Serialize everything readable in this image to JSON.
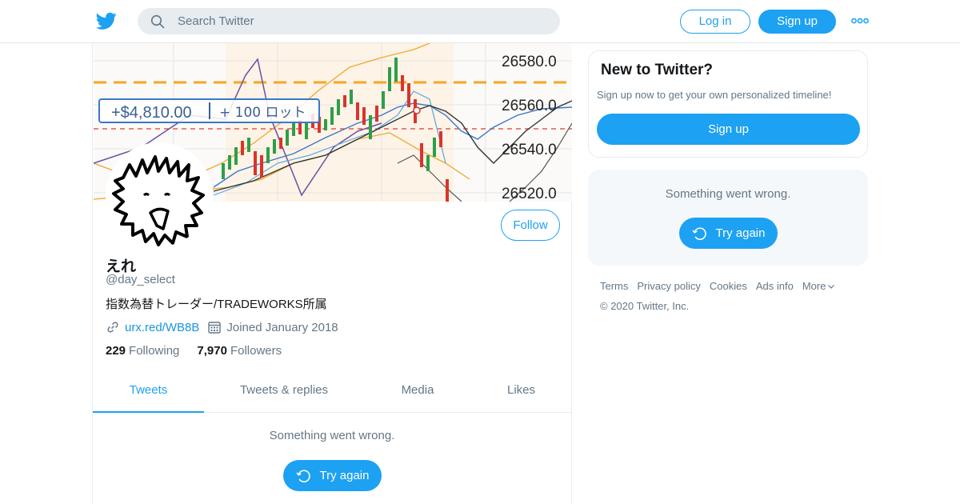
{
  "header": {
    "search_placeholder": "Search Twitter",
    "login_label": "Log in",
    "signup_label": "Sign up"
  },
  "profile": {
    "banner": {
      "price_levels": [
        "26580.0",
        "26560.0",
        "26540.0",
        "26520.0"
      ],
      "pnl_label": "+$4,810.00",
      "lot_label": "+ 100 ロット"
    },
    "follow_label": "Follow",
    "name": "えれ",
    "handle": "@day_select",
    "bio": "指数為替トレーダー/TRADEWORKS所属",
    "link": "urx.red/WB8B",
    "joined": "Joined January 2018",
    "following_count": "229",
    "following_label": "Following",
    "followers_count": "7,970",
    "followers_label": "Followers"
  },
  "tabs": [
    {
      "label": "Tweets",
      "active": true
    },
    {
      "label": "Tweets & replies",
      "active": false
    },
    {
      "label": "Media",
      "active": false
    },
    {
      "label": "Likes",
      "active": false
    }
  ],
  "timeline": {
    "error_text": "Something went wrong.",
    "retry_label": "Try again"
  },
  "sidebar": {
    "new_title": "New to Twitter?",
    "new_text": "Sign up now to get your own personalized timeline!",
    "signup_label": "Sign up",
    "error_text": "Something went wrong.",
    "retry_label": "Try again",
    "footer_links": [
      "Terms",
      "Privacy policy",
      "Cookies",
      "Ads info",
      "More"
    ],
    "copyright": "© 2020 Twitter, Inc."
  },
  "colors": {
    "accent": "#1da1f2",
    "secondary_text": "#657786"
  }
}
